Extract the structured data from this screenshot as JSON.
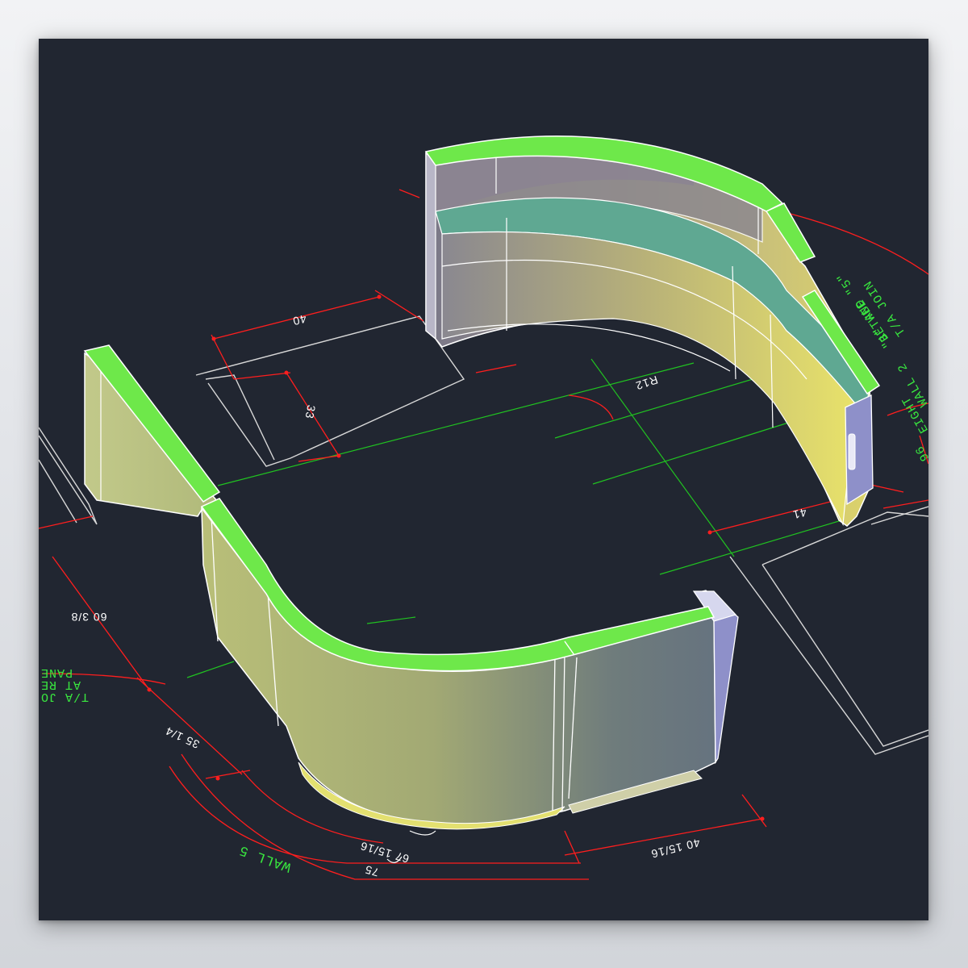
{
  "drawing": {
    "colors": {
      "background": "#212631",
      "dimension_line": "#ff1a1a",
      "centerline": "#23c423",
      "cap": "#6ee84a",
      "outline": "#ffffff"
    },
    "dimensions": {
      "d40_top": "40",
      "d33": "33",
      "r12": "R12",
      "d41": "41",
      "d60_3_8": "60 3/8",
      "d35_1_4": "35 1/4",
      "d67_15_16": "67 15/16",
      "d75": "75",
      "d40_15_16": "40 15/16"
    },
    "notes": {
      "wall5": "WALL 5",
      "left_note_1": "T/A JO",
      "left_note_2": "AT RE",
      "left_note_3": "PANE",
      "right_note_1": "\"1\" AND \"5\"",
      "right_note_2": "BETWEE",
      "right_note_3": "T/A JOIN",
      "right_wall": "WALL 2",
      "right_height": "EIGHT",
      "right_num": "96"
    }
  }
}
